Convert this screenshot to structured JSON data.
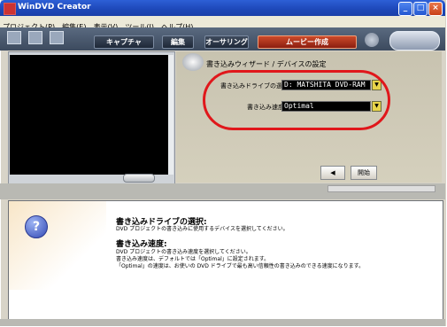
{
  "window": {
    "title": "WinDVD Creator"
  },
  "menu": [
    "プロジェクト(P)",
    "編集(E)",
    "表示(V)",
    "ツール(I)",
    "ヘルプ(H)"
  ],
  "toolbar": {
    "tabs": [
      "キャプチャ",
      "編集",
      "オーサリング",
      "ムービー作成"
    ],
    "active_tab": "ムービー作成"
  },
  "wizard": {
    "title": "書き込みウィザード / デバイスの設定",
    "drive_label": "書き込みドライブの選択",
    "drive_value": "D: MATSHITA DVD-RAM",
    "speed_label": "書き込み速度",
    "speed_value": "Optimal",
    "back_button": "◀",
    "start_button": "開始"
  },
  "help": {
    "heading1": "書き込みドライブの選択:",
    "text1": "DVD プロジェクトの書き込みに使用するデバイスを選択してください。",
    "heading2": "書き込み速度:",
    "text2_line1": "DVD プロジェクトの書き込み速度を選択してください。",
    "text2_line2": "書き込み速度は、デフォルトでは「Optimal」に設定されます。",
    "text2_line3": "「Optimal」の速度は、お使いの DVD ドライブで最も高い信頼性の書き込みのできる速度になります。"
  },
  "colors": {
    "highlight_oval": "#e0171b",
    "active_tab": "#cc4a2a"
  }
}
